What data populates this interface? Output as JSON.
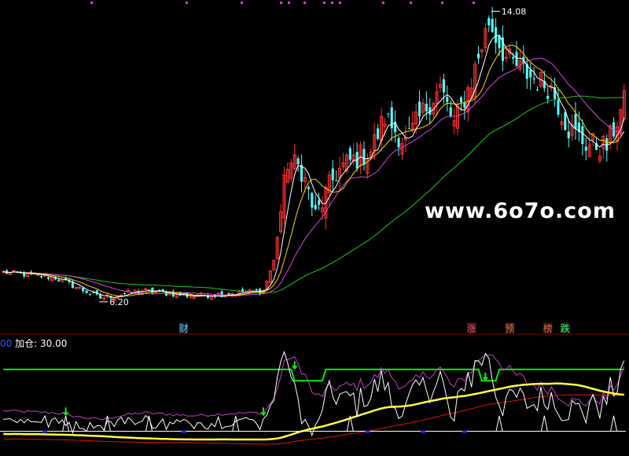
{
  "watermark": "www.6o7o.com",
  "colors": {
    "up": "#ff3333",
    "down": "#54fcfc",
    "ma5": "#ffffff",
    "ma10": "#ffd700",
    "ma20": "#e040e0",
    "ma60": "#19c819",
    "lower_green": "#00ee00",
    "lower_yellow": "#ffff44",
    "lower_red": "#e01010",
    "lower_purple": "#c040c0",
    "lower_white": "#ffffff",
    "arrow": "#22dd22"
  },
  "main_annotations": {
    "high_label": "14.08",
    "low_label": "6.20"
  },
  "event_markers": [
    {
      "label": "财",
      "x_index": 52,
      "color": "#66ccff"
    },
    {
      "label": "涨",
      "x_index": 135,
      "color": "#ff5050"
    },
    {
      "label": "预",
      "x_index": 146,
      "color": "#ff6633"
    },
    {
      "label": "榜",
      "x_index": 157,
      "color": "#ff6633"
    },
    {
      "label": "跌",
      "x_index": 162,
      "color": "#33ff66"
    }
  ],
  "indicator": {
    "prefix": "00",
    "name": "加仓:",
    "value": "30.00"
  },
  "chart_data": {
    "type": "candlestick",
    "price_range": [
      5.6,
      14.3
    ],
    "n_bars": 180,
    "key_points": [
      {
        "i": 0,
        "price": 7.0
      },
      {
        "i": 15,
        "price": 6.85
      },
      {
        "i": 28,
        "price": 6.3
      },
      {
        "i": 40,
        "price": 6.5
      },
      {
        "i": 55,
        "price": 6.35
      },
      {
        "i": 75,
        "price": 6.5
      },
      {
        "i": 78,
        "price": 7.3
      },
      {
        "i": 82,
        "price": 10.0
      },
      {
        "i": 86,
        "price": 9.8
      },
      {
        "i": 90,
        "price": 8.5
      },
      {
        "i": 96,
        "price": 9.7
      },
      {
        "i": 100,
        "price": 10.0
      },
      {
        "i": 106,
        "price": 10.3
      },
      {
        "i": 110,
        "price": 11.2
      },
      {
        "i": 116,
        "price": 10.5
      },
      {
        "i": 122,
        "price": 11.5
      },
      {
        "i": 126,
        "price": 12.0
      },
      {
        "i": 130,
        "price": 11.0
      },
      {
        "i": 135,
        "price": 12.2
      },
      {
        "i": 140,
        "price": 13.8
      },
      {
        "i": 145,
        "price": 12.8
      },
      {
        "i": 152,
        "price": 12.3
      },
      {
        "i": 158,
        "price": 12.0
      },
      {
        "i": 163,
        "price": 10.9
      },
      {
        "i": 168,
        "price": 10.5
      },
      {
        "i": 174,
        "price": 10.4
      },
      {
        "i": 179,
        "price": 11.6
      }
    ],
    "series": [
      {
        "name": "MA5"
      },
      {
        "name": "MA10"
      },
      {
        "name": "MA20"
      },
      {
        "name": "MA60"
      }
    ]
  }
}
